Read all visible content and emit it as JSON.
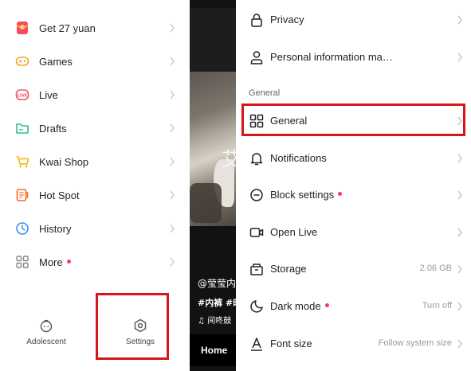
{
  "left_menu": {
    "items": [
      {
        "label": "Get 27 yuan",
        "icon": "red-envelope-icon",
        "dot": false
      },
      {
        "label": "Games",
        "icon": "gamepad-icon",
        "dot": false
      },
      {
        "label": "Live",
        "icon": "live-icon",
        "dot": false
      },
      {
        "label": "Drafts",
        "icon": "folder-icon",
        "dot": false
      },
      {
        "label": "Kwai Shop",
        "icon": "cart-icon",
        "dot": false
      },
      {
        "label": "Hot Spot",
        "icon": "hot-spot-icon",
        "dot": false
      },
      {
        "label": "History",
        "icon": "clock-icon",
        "dot": false
      },
      {
        "label": "More",
        "icon": "grid-icon",
        "dot": true
      }
    ],
    "bottom": {
      "adolescent_label": "Adolescent",
      "settings_label": "Settings"
    }
  },
  "video": {
    "overlay_char": "艾",
    "username": "@莹莹内",
    "tags": "#内裤 #时",
    "music": "间咚鼓",
    "home_label": "Home"
  },
  "settings": {
    "top_items": [
      {
        "label": "Privacy",
        "icon": "lock-icon"
      },
      {
        "label": "Personal information ma…",
        "icon": "person-icon"
      }
    ],
    "section_header": "General",
    "general_items": [
      {
        "label": "General",
        "icon": "grid-icon",
        "value": "",
        "dot": false
      },
      {
        "label": "Notifications",
        "icon": "bell-icon",
        "value": "",
        "dot": false
      },
      {
        "label": "Block settings",
        "icon": "block-icon",
        "value": "",
        "dot": true
      },
      {
        "label": "Open Live",
        "icon": "video-camera-icon",
        "value": "",
        "dot": false
      },
      {
        "label": "Storage",
        "icon": "storage-box-icon",
        "value": "2.06 GB",
        "dot": false
      },
      {
        "label": "Dark mode",
        "icon": "moon-icon",
        "value": "Turn off",
        "dot": true
      },
      {
        "label": "Font size",
        "icon": "font-size-icon",
        "value": "Follow system size",
        "dot": false
      }
    ]
  },
  "colors": {
    "highlight": "#d9151c",
    "dot": "#fe3666"
  }
}
